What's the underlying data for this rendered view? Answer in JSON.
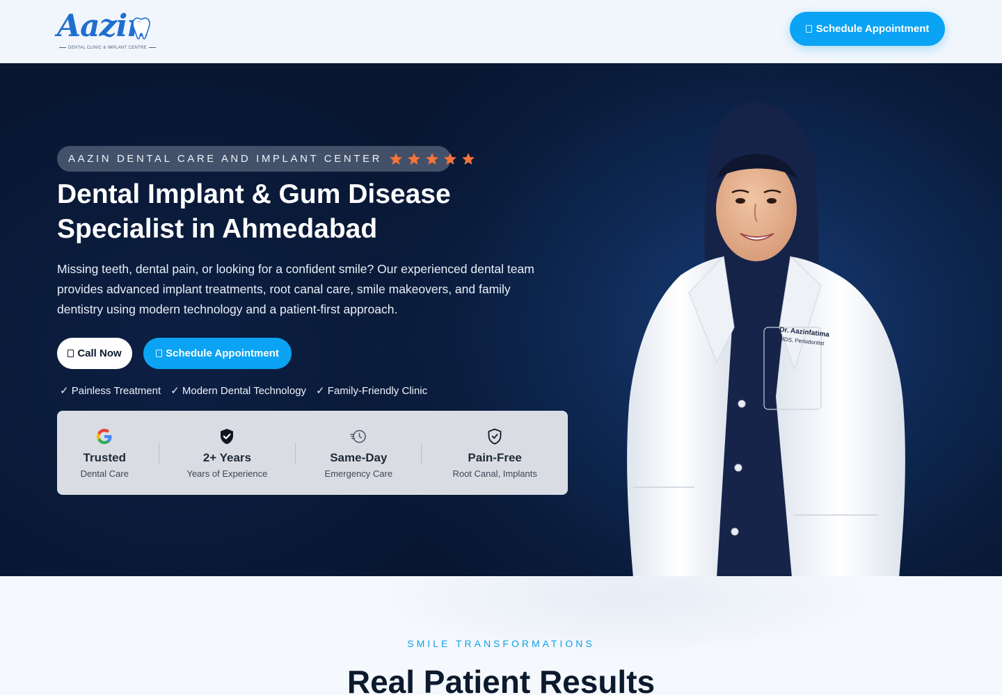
{
  "header": {
    "logo": {
      "word": "Aazin",
      "tagline": "DENTAL CLINIC & IMPLANT CENTRE"
    },
    "cta_icon": "calendar-icon",
    "cta_label": "Schedule Appointment"
  },
  "hero": {
    "badge": {
      "text": "AAZIN DENTAL CARE AND IMPLANT CENTER",
      "stars": 5,
      "star_color": "#f5743b"
    },
    "title": "Dental Implant & Gum Disease Specialist in Ahmedabad",
    "lead": "Missing teeth, dental pain, or looking for a confident smile? Our experienced dental team provides advanced implant treatments, root canal care, smile makeovers, and family dentistry using modern technology and a patient-first approach.",
    "buttons": {
      "call_label": "Call Now",
      "call_icon": "phone-icon",
      "schedule_label": "Schedule Appointment",
      "schedule_icon": "calendar-icon"
    },
    "features": [
      "✓ Painless Treatment",
      "✓ Modern Dental Technology",
      "✓ Family-Friendly Clinic"
    ],
    "stats": [
      {
        "icon": "google-icon",
        "title": "Trusted",
        "subtitle": "Dental Care"
      },
      {
        "icon": "shield-check-icon",
        "title": "2+ Years",
        "subtitle": "Years of Experience"
      },
      {
        "icon": "clock-history-icon",
        "title": "Same-Day",
        "subtitle": "Emergency Care"
      },
      {
        "icon": "shield-outline-check-icon",
        "title": "Pain-Free",
        "subtitle": "Root Canal, Implants"
      }
    ],
    "doctor_badge": {
      "name": "Dr. Aazinfatima",
      "credentials": "MDS, Periodontist"
    }
  },
  "section": {
    "kicker": "SMILE TRANSFORMATIONS",
    "title": "Real Patient Results"
  },
  "colors": {
    "accent": "#0ba3f3",
    "hero_bg": "#0a1c3c",
    "star": "#f5743b"
  }
}
